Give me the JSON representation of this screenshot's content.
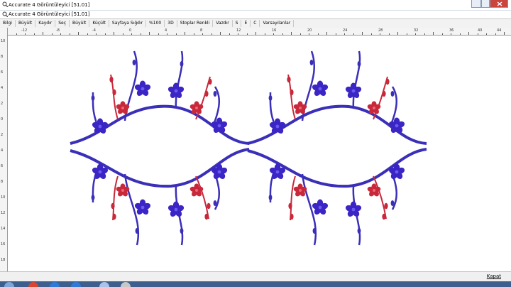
{
  "window": {
    "title": "Accurate 4 Görüntüleyici [51.01]",
    "inner_title": "Accurate 4 Görüntüleyici [51.01]"
  },
  "toolbar": {
    "items": [
      "Bilgi",
      "Büyült",
      "Kaydır",
      "Seç",
      "Büyült",
      "Küçült",
      "Sayfaya Sığdır",
      "%100",
      "3D",
      "Stoplar Renkli",
      "Vazdır",
      "S",
      "E",
      "C",
      "Varsayılanlar"
    ]
  },
  "ruler": {
    "top_labels": [
      "-12",
      "-8",
      "-4",
      "0",
      "4",
      "8",
      "12",
      "16",
      "20",
      "24",
      "28",
      "32",
      "36",
      "40",
      "44"
    ],
    "left_labels": [
      "10",
      "8",
      "6",
      "4",
      "2",
      "0",
      "2",
      "4",
      "6",
      "8",
      "10",
      "12",
      "14",
      "16",
      "18"
    ]
  },
  "design": {
    "colors": {
      "stem": "#3a2fb8",
      "flower_blue": "#3b25c4",
      "flower_red": "#c8283a"
    }
  },
  "status": {
    "close_label": "Kapat"
  }
}
